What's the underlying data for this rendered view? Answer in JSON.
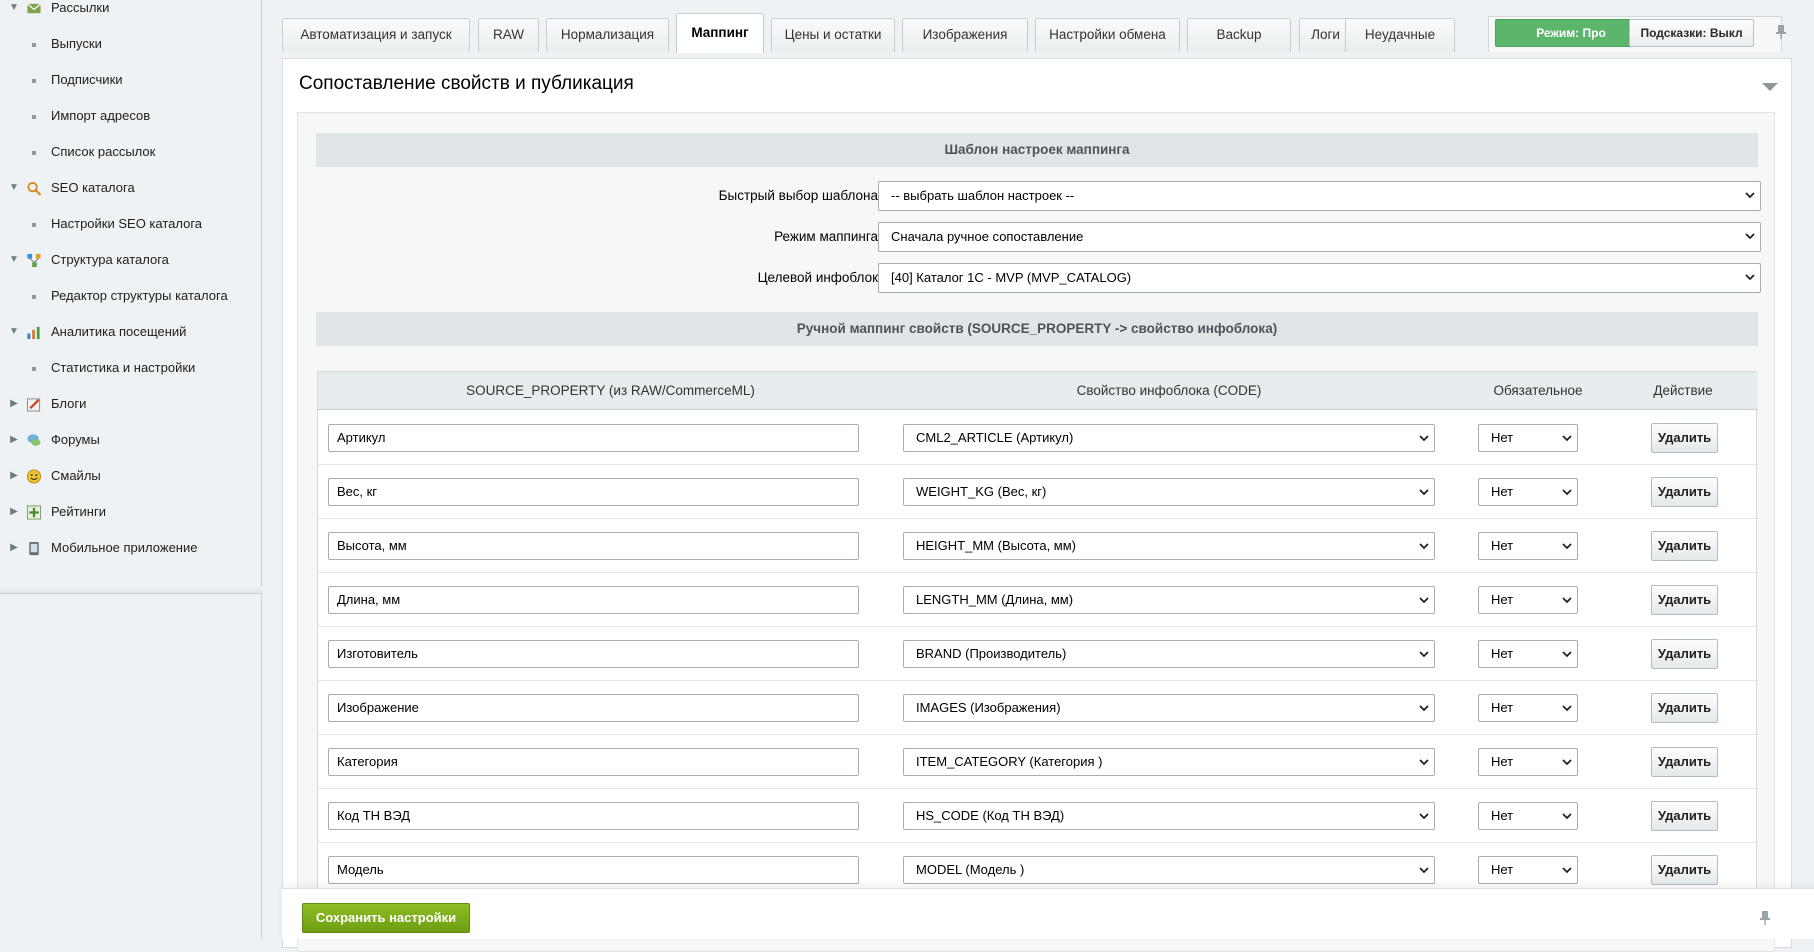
{
  "sidebar": {
    "items": [
      {
        "type": "group",
        "label": "Рассылки",
        "icon": "mail-icon"
      },
      {
        "type": "sub",
        "label": "Выпуски"
      },
      {
        "type": "sub",
        "label": "Подписчики"
      },
      {
        "type": "sub",
        "label": "Импорт адресов"
      },
      {
        "type": "sub",
        "label": "Список рассылок"
      },
      {
        "type": "group",
        "label": "SEO каталога",
        "icon": "seo-icon"
      },
      {
        "type": "sub",
        "label": "Настройки SEO каталога"
      },
      {
        "type": "group",
        "label": "Структура каталога",
        "icon": "structure-icon"
      },
      {
        "type": "sub",
        "label": "Редактор структуры каталога"
      },
      {
        "type": "group",
        "label": "Аналитика посещений",
        "icon": "analytics-icon"
      },
      {
        "type": "sub",
        "label": "Статистика и настройки"
      },
      {
        "type": "collapsed",
        "label": "Блоги",
        "icon": "blog-icon"
      },
      {
        "type": "collapsed",
        "label": "Форумы",
        "icon": "forum-icon"
      },
      {
        "type": "collapsed",
        "label": "Смайлы",
        "icon": "smile-icon"
      },
      {
        "type": "collapsed",
        "label": "Рейтинги",
        "icon": "rating-icon"
      },
      {
        "type": "collapsed",
        "label": "Мобильное приложение",
        "icon": "mobile-icon"
      }
    ]
  },
  "tabs": [
    {
      "label": "Автоматизация и запуск",
      "active": false
    },
    {
      "label": "RAW",
      "active": false
    },
    {
      "label": "Нормализация",
      "active": false
    },
    {
      "label": "Маппинг",
      "active": true
    },
    {
      "label": "Цены и остатки",
      "active": false
    },
    {
      "label": "Изображения",
      "active": false
    },
    {
      "label": "Настройки обмена",
      "active": false
    },
    {
      "label": "Backup",
      "active": false
    },
    {
      "label": "Логи",
      "active": false
    },
    {
      "label": "Неудачные",
      "active": false
    }
  ],
  "header_buttons": {
    "mode": "Режим: Про",
    "hints": "Подсказки: Выкл"
  },
  "panel": {
    "title": "Сопоставление свойств и публикация",
    "template_section": "Шаблон настроек маппинга",
    "fields": [
      {
        "label": "Быстрый выбор шаблона",
        "value": "-- выбрать шаблон настроек --"
      },
      {
        "label": "Режим маппинга",
        "value": "Сначала ручное сопоставление"
      },
      {
        "label": "Целевой инфоблок",
        "value": "[40] Каталог 1С - MVP (MVP_CATALOG)"
      }
    ],
    "manual_section": "Ручной маппинг свойств (SOURCE_PROPERTY -> свойство инфоблока)"
  },
  "table": {
    "headers": {
      "source": "SOURCE_PROPERTY (из RAW/CommerceML)",
      "property": "Свойство инфоблока (CODE)",
      "required": "Обязательное",
      "action": "Действие"
    },
    "rows": [
      {
        "source": "Артикул",
        "property": "CML2_ARTICLE (Артикул)",
        "required": "Нет",
        "action": "Удалить"
      },
      {
        "source": "Вес, кг",
        "property": "WEIGHT_KG (Вес, кг)",
        "required": "Нет",
        "action": "Удалить"
      },
      {
        "source": "Высота, мм",
        "property": "HEIGHT_MM (Высота, мм)",
        "required": "Нет",
        "action": "Удалить"
      },
      {
        "source": "Длина, мм",
        "property": "LENGTH_MM (Длина, мм)",
        "required": "Нет",
        "action": "Удалить"
      },
      {
        "source": "Изготовитель",
        "property": "BRAND (Производитель)",
        "required": "Нет",
        "action": "Удалить"
      },
      {
        "source": "Изображение",
        "property": "IMAGES (Изображения)",
        "required": "Нет",
        "action": "Удалить"
      },
      {
        "source": "Категория",
        "property": "ITEM_CATEGORY (Категория )",
        "required": "Нет",
        "action": "Удалить"
      },
      {
        "source": "Код ТН ВЭД",
        "property": "HS_CODE (Код ТН ВЭД)",
        "required": "Нет",
        "action": "Удалить"
      },
      {
        "source": "Модель",
        "property": "MODEL (Модель )",
        "required": "Нет",
        "action": "Удалить"
      }
    ]
  },
  "footer": {
    "save_label": "Сохранить настройки"
  },
  "colors": {
    "mode_button": "#5bb66b",
    "save_button": "#7aac18",
    "section_header": "#e0e6e8"
  }
}
